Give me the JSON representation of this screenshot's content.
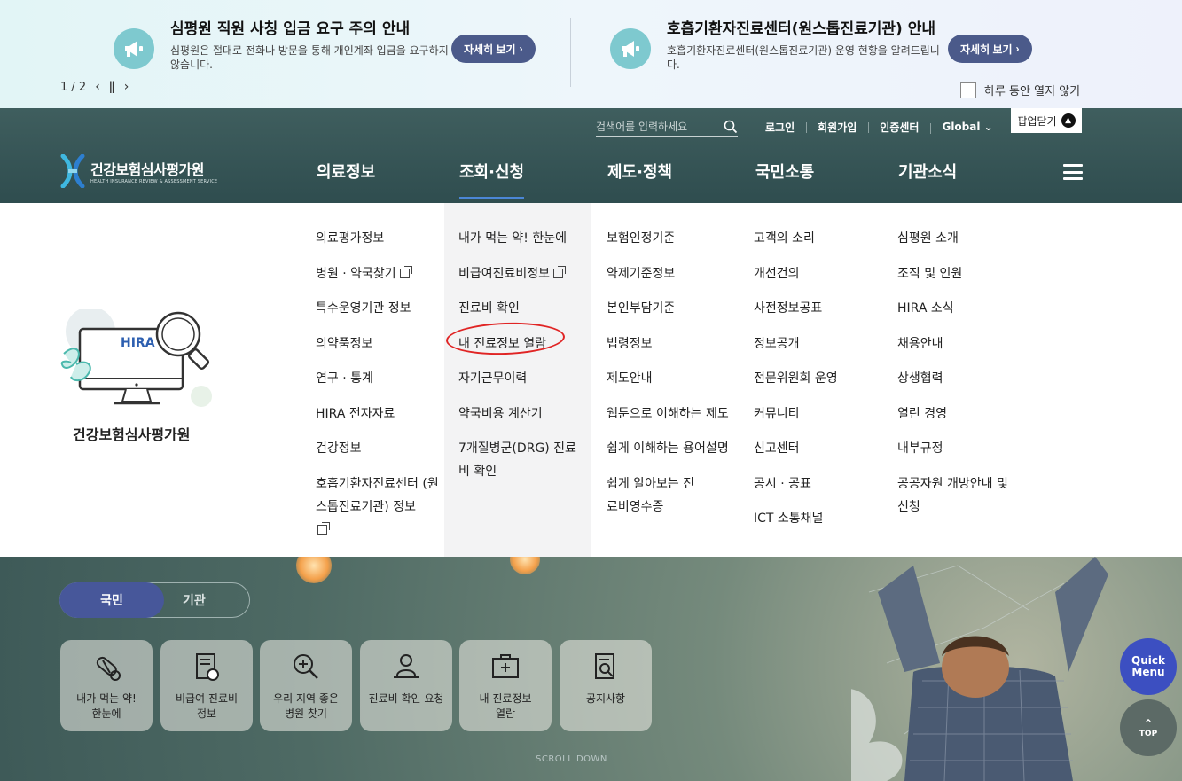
{
  "popup": {
    "notices": [
      {
        "title": "심평원 직원 사칭 입금 요구 주의 안내",
        "desc": "심평원은 절대로 전화나 방문을 통해 개인계좌 입금을 요구하지 않습니다.",
        "button": "자세히 보기"
      },
      {
        "title": "호흡기환자진료센터(원스톱진료기관) 안내",
        "desc": "호흡기환자진료센터(원스톱진료기관) 운영 현황을 알려드립니다.",
        "button": "자세히 보기"
      }
    ],
    "pager": "1 / 2",
    "dont_show": "하루 동안 열지 않기",
    "close": "팝업닫기"
  },
  "header": {
    "search_placeholder": "검색어를 입력하세요",
    "util_links": [
      "로그인",
      "회원가입",
      "인증센터",
      "Global"
    ],
    "logo_kr": "건강보험심사평가원",
    "logo_en": "HEALTH INSURANCE REVIEW & ASSESSMENT SERVICE",
    "menus": [
      "의료정보",
      "조회·신청",
      "제도·정책",
      "국민소통",
      "기관소식"
    ]
  },
  "dropdown": {
    "brand_caption": "건강보험심사평가원",
    "brand_badge": "HIRA",
    "columns": [
      [
        "의료평가정보",
        "병원 · 약국찾기",
        "특수운영기관 정보",
        "의약품정보",
        "연구 · 통계",
        "HIRA 전자자료",
        "건강정보",
        "호흡기환자진료센터 (원스톱진료기관) 정보"
      ],
      [
        "내가 먹는 약! 한눈에",
        "비급여진료비정보",
        "진료비 확인",
        "내 진료정보 열람",
        "자기근무이력",
        "약국비용 계산기",
        "7개질병군(DRG) 진료비 확인"
      ],
      [
        "보험인정기준",
        "약제기준정보",
        "본인부담기준",
        "법령정보",
        "제도안내",
        "웹툰으로 이해하는 제도",
        "쉽게 이해하는 용어설명",
        "쉽게 알아보는 진료비영수증"
      ],
      [
        "고객의 소리",
        "개선건의",
        "사전정보공표",
        "정보공개",
        "전문위원회 운영",
        "커뮤니티",
        "신고센터",
        "공시 · 공표",
        "ICT 소통채널"
      ],
      [
        "심평원 소개",
        "조직 및 인원",
        "HIRA 소식",
        "채용안내",
        "상생협력",
        "열린 경영",
        "내부규정",
        "공공자원 개방안내 및 신청"
      ]
    ]
  },
  "hero": {
    "toggle_on": "국민",
    "toggle_off": "기관",
    "quick_links": [
      "내가 먹는 약! 한눈에",
      "비급여 진료비 정보",
      "우리 지역 좋은 병원 찾기",
      "진료비 확인 요청",
      "내 진료정보 열람",
      "공지사항"
    ],
    "scroll_down": "SCROLL DOWN",
    "quick_menu": "Quick Menu",
    "top": "TOP"
  }
}
